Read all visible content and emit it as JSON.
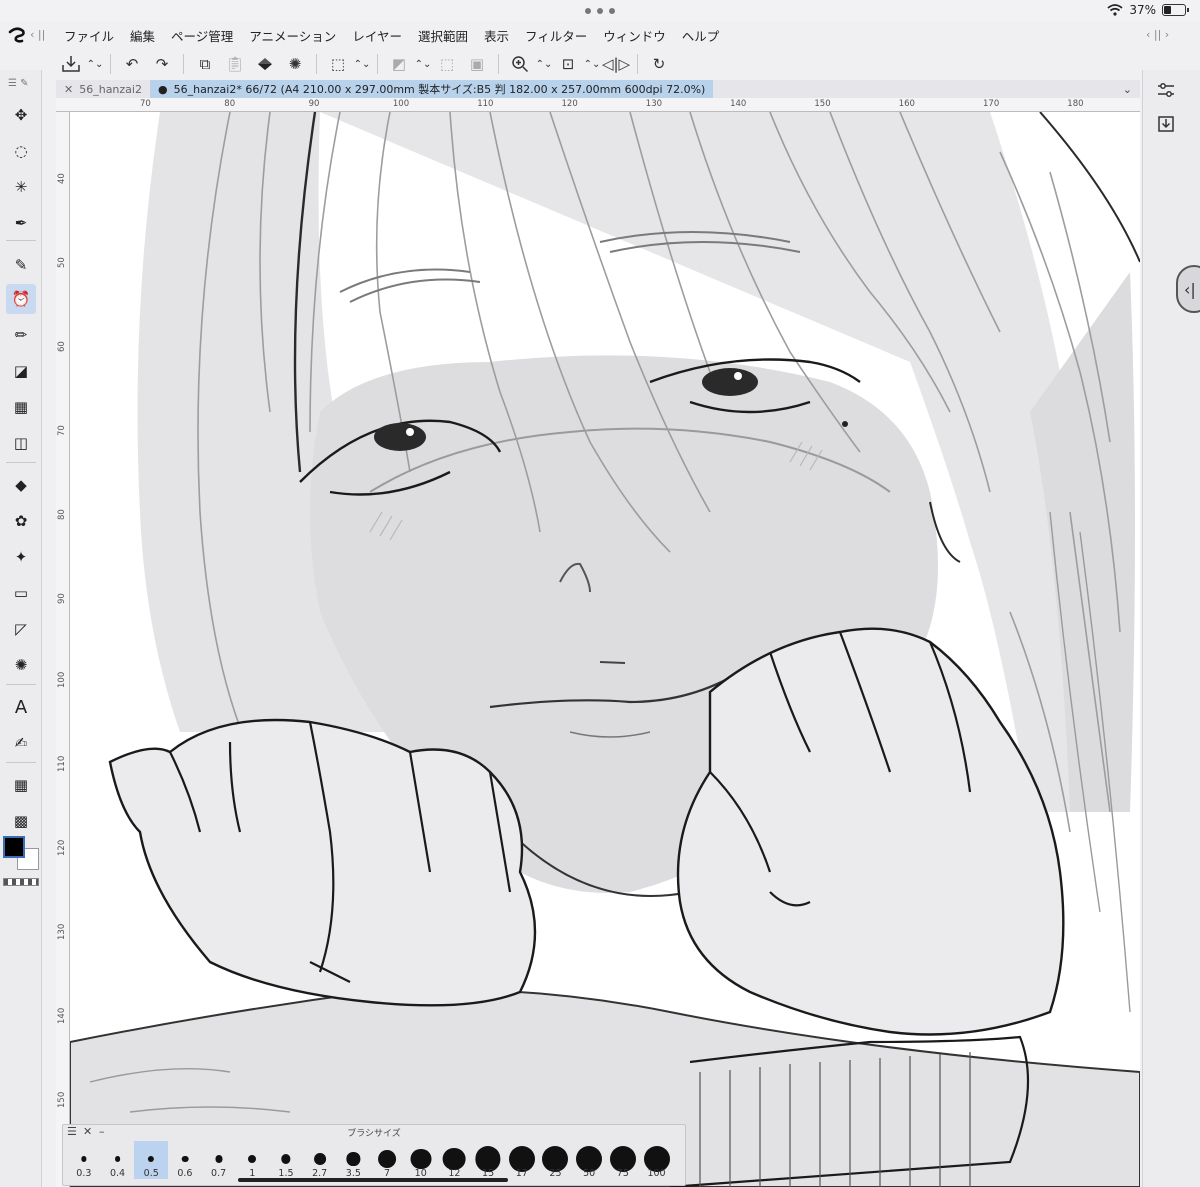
{
  "status": {
    "battery": "37%",
    "battery_level": 0.37
  },
  "menu": [
    "ファイル",
    "編集",
    "ページ管理",
    "アニメーション",
    "レイヤー",
    "選択範囲",
    "表示",
    "フィルター",
    "ウィンドウ",
    "ヘルプ"
  ],
  "tabs": {
    "inactive": "56_hanzai2",
    "active": "56_hanzai2* 66/72 (A4 210.00 x 297.00mm 製本サイズ:B5 判 182.00 x 257.00mm 600dpi 72.0%)"
  },
  "ruler_top": [
    "70",
    "80",
    "90",
    "100",
    "110",
    "120",
    "130",
    "140",
    "150",
    "160",
    "170",
    "180"
  ],
  "ruler_left": [
    "40",
    "50",
    "60",
    "70",
    "80",
    "90",
    "100",
    "110",
    "120",
    "130",
    "140",
    "150"
  ],
  "brush_palette": {
    "title": "ブラシサイズ",
    "selected": "0.5",
    "sizes": [
      "0.3",
      "0.4",
      "0.5",
      "0.6",
      "0.7",
      "1",
      "1.5",
      "2.7",
      "3.5",
      "7",
      "10",
      "12",
      "15",
      "17",
      "25",
      "50",
      "75",
      "100"
    ]
  },
  "colors": {
    "main": "#000000",
    "sub": "#ffffff",
    "accent": "#b9d2ec"
  },
  "icons": {
    "tools": [
      "operation-icon",
      "lasso-select-icon",
      "magic-wand-icon",
      "eyedropper-icon",
      "pen-icon",
      "pencil-icon",
      "marker-icon",
      "brush-icon",
      "frame-border-icon",
      "eraser-icon",
      "fill-icon",
      "decoration-icon",
      "blend-icon",
      "gradient-icon",
      "figure-icon",
      "effect-line-icon",
      "text-icon",
      "correct-line-icon",
      "ruler-icon",
      "tone-icon"
    ]
  }
}
